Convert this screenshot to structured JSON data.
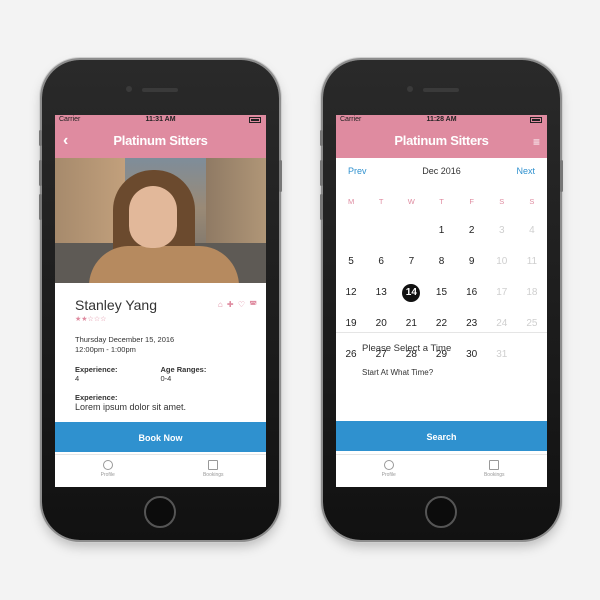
{
  "left_phone": {
    "status": {
      "carrier": "Carrier",
      "time": "11:31 AM"
    },
    "nav": {
      "logo": "Platinum Sitters"
    },
    "profile": {
      "name": "Stanley Yang",
      "rating_stars": "★★☆☆☆",
      "rating": 2,
      "rating_max": 5,
      "service_icons": "⌂ ✚ ♡ ◚",
      "date": "Thursday December 15, 2016",
      "time_range": "12:00pm - 1:00pm",
      "experience_label": "Experience:",
      "experience_value": "4",
      "age_label": "Age Ranges:",
      "age_value": "0-4",
      "experience2_label": "Experience:",
      "experience2_value": "Lorem ipsum dolor sit amet."
    },
    "action_label": "Book Now",
    "tabs": {
      "profile": "Profile",
      "bookings": "Bookings"
    }
  },
  "right_phone": {
    "status": {
      "carrier": "Carrier",
      "time": "11:28 AM"
    },
    "nav": {
      "logo": "Platinum Sitters",
      "menu_icon": "≡"
    },
    "calendar": {
      "prev": "Prev",
      "month": "Dec 2016",
      "next": "Next",
      "days_of_week": [
        "M",
        "T",
        "W",
        "T",
        "F",
        "S",
        "S"
      ],
      "selected_day": "14",
      "weeks": [
        [
          "",
          "",
          "",
          "1",
          "2",
          "3",
          "4"
        ],
        [
          "5",
          "6",
          "7",
          "8",
          "9",
          "10",
          "11"
        ],
        [
          "12",
          "13",
          "14",
          "15",
          "16",
          "17",
          "18"
        ],
        [
          "19",
          "20",
          "21",
          "22",
          "23",
          "24",
          "25"
        ],
        [
          "26",
          "27",
          "28",
          "29",
          "30",
          "31",
          ""
        ]
      ],
      "muted_days": [
        "3",
        "4",
        "10",
        "11",
        "17",
        "18",
        "24",
        "25",
        "31"
      ]
    },
    "time_section": {
      "title": "Please Select a Time",
      "start_label": "Start At What Time?"
    },
    "action_label": "Search",
    "tabs": {
      "profile": "Profile",
      "bookings": "Bookings"
    }
  }
}
